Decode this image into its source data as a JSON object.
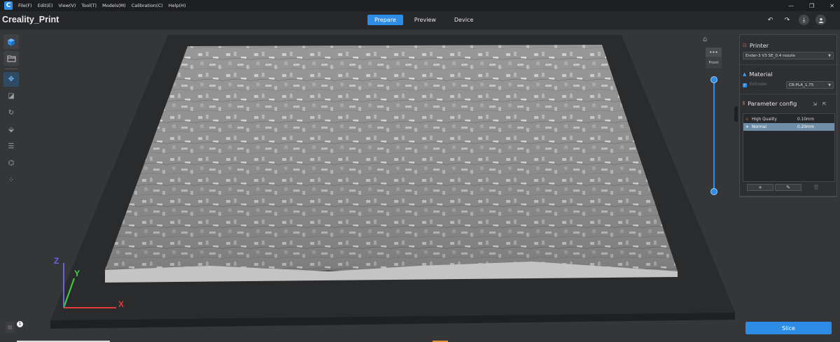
{
  "app": {
    "logo_glyph": "C",
    "title": "Creality_Print"
  },
  "menu": {
    "items": [
      "File(F)",
      "Edit(E)",
      "View(V)",
      "Tool(T)",
      "Models(M)",
      "Calibration(C)",
      "Help(H)"
    ]
  },
  "window": {
    "minimize": "—",
    "maximize": "❐",
    "close": "✕"
  },
  "tabs": [
    {
      "label": "Prepare",
      "active": true
    },
    {
      "label": "Preview",
      "active": false
    },
    {
      "label": "Device",
      "active": false
    }
  ],
  "top_actions": {
    "undo_icon": "↶",
    "redo_icon": "↷",
    "download_icon": "⤓",
    "account_icon": "👤"
  },
  "left_tools": {
    "add_model_icon": "cube-icon",
    "open_icon": "folder-icon",
    "move_icon": "✥",
    "scale_icon": "◪",
    "rotate_icon": "↻",
    "lay_flat_icon": "⬙",
    "layers_icon": "☰",
    "support_icon": "⌬",
    "arrange_icon": "⁘"
  },
  "view_widget": {
    "home_icon": "⌂",
    "cube_top": "•••",
    "cube_front": "Front"
  },
  "panel": {
    "printer": {
      "title": "Printer",
      "icon": "⊡",
      "selected": "Ender-3 V3 SE_0.4 nozzle"
    },
    "material": {
      "title": "Material",
      "icon": "▲",
      "extruder_label": "Extruder",
      "extruder_checked": true,
      "selected": "CR-PLA_1.75"
    },
    "parameter_config": {
      "title": "Parameter config",
      "icon": "⦀",
      "presets": [
        {
          "name": "High Quality",
          "value": "0.10mm",
          "selected": false,
          "icon": "✩"
        },
        {
          "name": "Normal",
          "value": "0.20mm",
          "selected": true,
          "icon": "✈"
        }
      ],
      "add_label": "+",
      "edit_label": "✎",
      "delete_label": "🗑"
    }
  },
  "slice_button": "Slice",
  "notification_count": "1",
  "layer_slider": {
    "top_value": 1.0,
    "bottom_value": 0.0
  },
  "axes": {
    "x": "X",
    "y": "Y",
    "z": "Z",
    "x_color": "#e23a3a",
    "y_color": "#3ed13e",
    "z_color": "#6b62e8"
  },
  "colors": {
    "accent": "#2d8ce6",
    "panel_bg": "#2e2f32",
    "viewport_bg": "#353638",
    "plate_dark": "#262729"
  }
}
